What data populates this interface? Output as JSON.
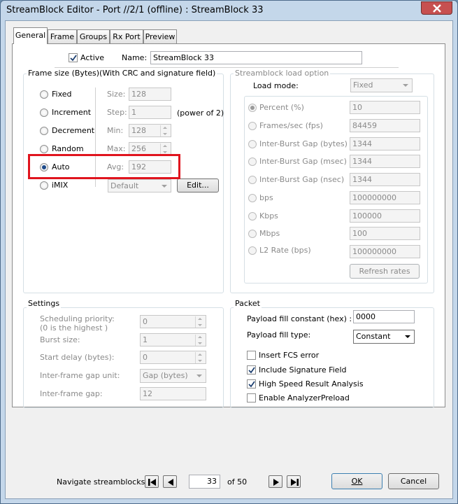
{
  "window": {
    "title": "StreamBlock Editor - Port //2/1 (offline) : StreamBlock 33"
  },
  "tabs": [
    "General",
    "Frame",
    "Groups",
    "Rx Port",
    "Preview"
  ],
  "active_label": "Active",
  "name_label": "Name:",
  "name_value": "StreamBlock 33",
  "frame_size": {
    "title": "Frame size (Bytes)(With CRC and signature field)",
    "options": [
      "Fixed",
      "Increment",
      "Decrement",
      "Random",
      "Auto",
      "iMIX"
    ],
    "size_label": "Size:",
    "size_value": "128",
    "step_label": "Step:",
    "step_value": "1",
    "step_note": "(power of 2)",
    "min_label": "Min:",
    "min_value": "128",
    "max_label": "Max:",
    "max_value": "256",
    "avg_label": "Avg:",
    "avg_value": "192",
    "imix_value": "Default",
    "edit_label": "Edit..."
  },
  "load_option": {
    "title": "Streamblock load option",
    "mode_label": "Load mode:",
    "mode_value": "Fixed",
    "rows": [
      {
        "label": "Percent (%)",
        "value": "10"
      },
      {
        "label": "Frames/sec (fps)",
        "value": "84459"
      },
      {
        "label": "Inter-Burst Gap (bytes)",
        "value": "1344"
      },
      {
        "label": "Inter-Burst Gap (msec)",
        "value": "1344"
      },
      {
        "label": "Inter-Burst Gap (nsec)",
        "value": "1344"
      },
      {
        "label": "bps",
        "value": "100000000"
      },
      {
        "label": "Kbps",
        "value": "100000"
      },
      {
        "label": "Mbps",
        "value": "100"
      },
      {
        "label": "L2 Rate (bps)",
        "value": "100000000"
      }
    ],
    "refresh_label": "Refresh rates"
  },
  "settings": {
    "title": "Settings",
    "priority_label_1": "Scheduling priority:",
    "priority_label_2": "(0 is the highest )",
    "priority_value": "0",
    "burst_label": "Burst size:",
    "burst_value": "1",
    "start_delay_label": "Start delay (bytes):",
    "start_delay_value": "0",
    "ifg_unit_label": "Inter-frame gap unit:",
    "ifg_unit_value": "Gap (bytes)",
    "ifg_label": "Inter-frame gap:",
    "ifg_value": "12"
  },
  "packet": {
    "title": "Packet",
    "fill_constant_label": "Payload fill constant (hex) :",
    "fill_constant_value": "0000",
    "fill_type_label": "Payload fill type:",
    "fill_type_value": "Constant",
    "checks": [
      {
        "label": "Insert FCS error",
        "checked": false
      },
      {
        "label": "Include Signature Field",
        "checked": true
      },
      {
        "label": "High Speed Result Analysis",
        "checked": true
      },
      {
        "label": "Enable AnalyzerPreload",
        "checked": false
      }
    ]
  },
  "footer": {
    "navigate_label": "Navigate streamblocks:",
    "current": "33",
    "of_label": "of 50",
    "ok_label": "OK",
    "cancel_label": "Cancel"
  },
  "colors": {
    "highlight": "#e0141e",
    "title_bar": "#c4d7ea",
    "close_button": "#c75050"
  }
}
